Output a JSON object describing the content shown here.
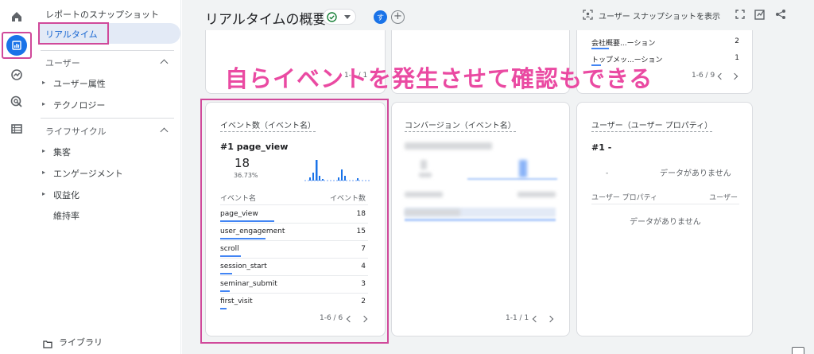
{
  "nav": {
    "snapshot_link": "レポートのスナップショット",
    "realtime_link": "リアルタイム",
    "user_section": "ユーザー",
    "user_items": [
      "ユーザー属性",
      "テクノロジー"
    ],
    "lifecycle_section": "ライフサイクル",
    "lifecycle_items": [
      "集客",
      "エンゲージメント",
      "収益化"
    ],
    "retention": "維持率",
    "library": "ライブラリ"
  },
  "header": {
    "title": "リアルタイムの概要",
    "avatar_letter": "す",
    "snapshot_button": "ユーザー スナップショットを表示"
  },
  "top_right_card": {
    "rows": [
      {
        "name": "会社概要...ーション",
        "value": "2"
      },
      {
        "name": "トップメッ...ーション",
        "value": "1"
      }
    ],
    "pager": "1-6 / 9"
  },
  "top_left_partial_pager": "1-1 / 1",
  "top_mid_partial_pager": "1 /",
  "overlay_caption": "自らイベントを発生させて確認もできる",
  "event_card": {
    "title": "イベント数（イベント名）",
    "top_label": "#1  page_view",
    "top_value": "18",
    "top_percent": "36.73%",
    "col_name": "イベント名",
    "col_value": "イベント数",
    "rows": [
      {
        "name": "page_view",
        "value": "18",
        "share": 1.0
      },
      {
        "name": "user_engagement",
        "value": "15",
        "share": 0.83
      },
      {
        "name": "scroll",
        "value": "7",
        "share": 0.39
      },
      {
        "name": "session_start",
        "value": "4",
        "share": 0.22
      },
      {
        "name": "seminar_submit",
        "value": "3",
        "share": 0.17
      },
      {
        "name": "first_visit",
        "value": "2",
        "share": 0.11
      }
    ],
    "pager": "1-6 / 6"
  },
  "conversion_card": {
    "title": "コンバージョン（イベント名）",
    "pager": "1-1 / 1"
  },
  "user_prop_card": {
    "title": "ユーザー（ユーザー プロパティ）",
    "top_label": "#1  -",
    "no_data_1": "データがありません",
    "col_name": "ユーザー プロパティ",
    "col_value": "ユーザー",
    "no_data_2": "データがありません"
  },
  "colors": {
    "accent": "#1a73e8",
    "highlight": "#d0499a",
    "caption": "#ea4aa2"
  }
}
